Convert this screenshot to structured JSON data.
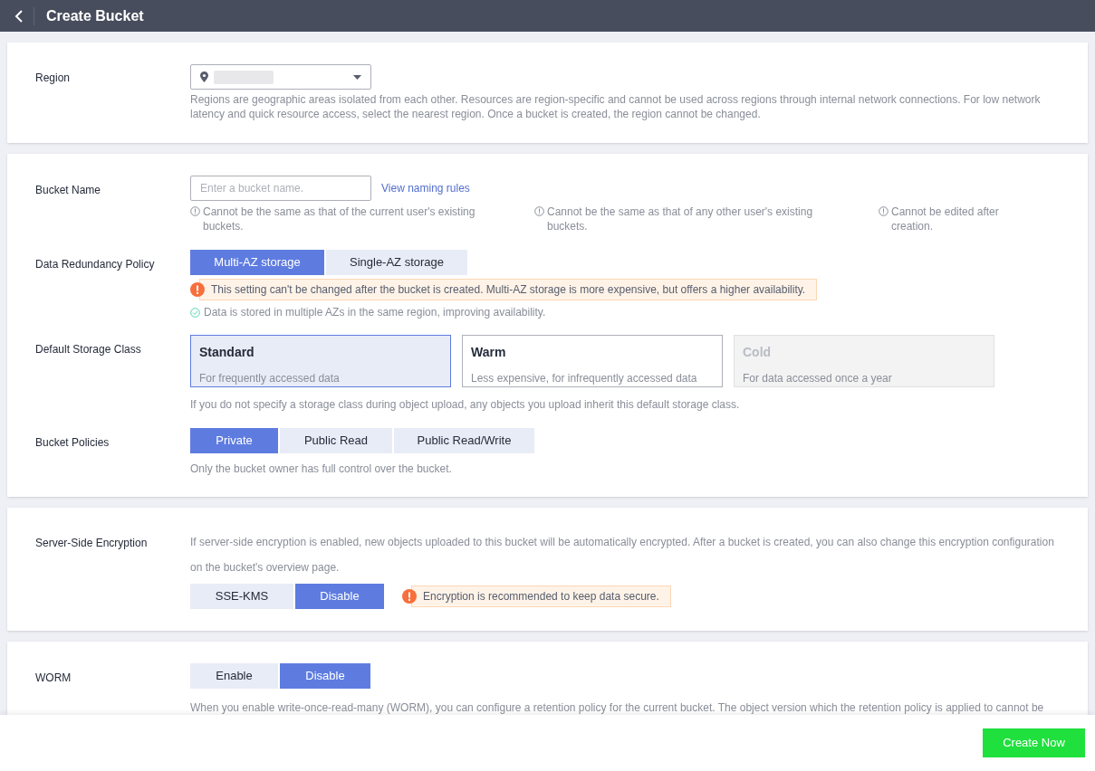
{
  "header": {
    "title": "Create Bucket"
  },
  "region": {
    "label": "Region",
    "hint": "Regions are geographic areas isolated from each other. Resources are region-specific and cannot be used across regions through internal network connections. For low network latency and quick resource access, select the nearest region. Once a bucket is created, the region cannot be changed."
  },
  "bucket_name": {
    "label": "Bucket Name",
    "placeholder": "Enter a bucket name.",
    "link": "View naming rules",
    "rules": [
      "Cannot be the same as that of the current user's existing buckets.",
      "Cannot be the same as that of any other user's existing buckets.",
      "Cannot be edited after creation."
    ]
  },
  "redundancy": {
    "label": "Data Redundancy Policy",
    "options": [
      {
        "label": "Multi-AZ storage",
        "selected": true
      },
      {
        "label": "Single-AZ storage",
        "selected": false
      }
    ],
    "warning": "This setting can't be changed after the bucket is created. Multi-AZ storage is more expensive, but offers a higher availability.",
    "note": "Data is stored in multiple AZs in the same region, improving availability."
  },
  "storage_class": {
    "label": "Default Storage Class",
    "options": [
      {
        "name": "Standard",
        "description": "For frequently accessed data",
        "selected": true,
        "disabled": false
      },
      {
        "name": "Warm",
        "description": "Less expensive, for infrequently accessed data",
        "selected": false,
        "disabled": false
      },
      {
        "name": "Cold",
        "description": "For data accessed once a year",
        "selected": false,
        "disabled": true
      }
    ],
    "hint": "If you do not specify a storage class during object upload, any objects you upload inherit this default storage class."
  },
  "policies": {
    "label": "Bucket Policies",
    "options": [
      {
        "label": "Private",
        "selected": true
      },
      {
        "label": "Public Read",
        "selected": false
      },
      {
        "label": "Public Read/Write",
        "selected": false
      }
    ],
    "hint": "Only the bucket owner has full control over the bucket."
  },
  "encryption": {
    "label": "Server-Side Encryption",
    "description": "If server-side encryption is enabled, new objects uploaded to this bucket will be automatically encrypted. After a bucket is created, you can also change this encryption configuration on the bucket's overview page.",
    "options": [
      {
        "label": "SSE-KMS",
        "selected": false
      },
      {
        "label": "Disable",
        "selected": true
      }
    ],
    "warning": "Encryption is recommended to keep data secure."
  },
  "worm": {
    "label": "WORM",
    "options": [
      {
        "label": "Enable",
        "selected": false
      },
      {
        "label": "Disable",
        "selected": true
      }
    ],
    "description": "When you enable write-once-read-many (WORM), you can configure a retention policy for the current bucket. The object version which the retention policy is applied to cannot be"
  },
  "footer": {
    "button": "Create Now"
  }
}
